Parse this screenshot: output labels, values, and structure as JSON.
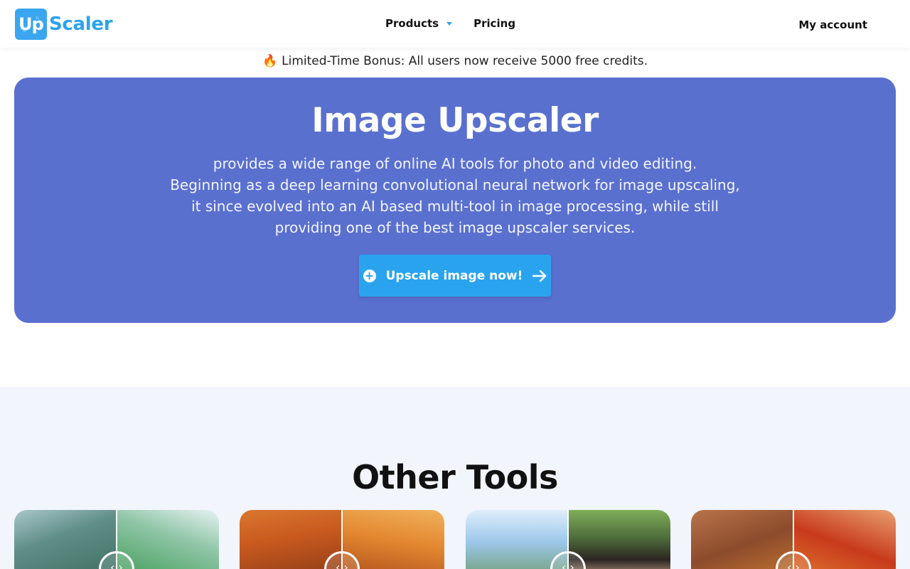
{
  "header": {
    "logo_badge": "Up",
    "logo_text": "Scaler",
    "nav": [
      {
        "label": "Products",
        "has_dropdown": true
      },
      {
        "label": "Pricing",
        "has_dropdown": false
      }
    ],
    "account_label": "My account"
  },
  "promo": {
    "icon": "fire-icon",
    "text": "Limited-Time Bonus: All users now receive 5000 free credits."
  },
  "hero": {
    "title": "Image Upscaler",
    "description_lines": [
      "provides a wide range of online AI tools for photo and video editing.",
      "Beginning as a deep learning convolutional neural network for image upscaling,",
      "it since evolved into an AI based multi-tool in image processing, while still",
      "providing one of the best image upscaler services."
    ],
    "cta_label": "Upscale image now!"
  },
  "tools": {
    "title": "Other Tools",
    "cards": [
      {
        "name": "tool-card-1"
      },
      {
        "name": "tool-card-2"
      },
      {
        "name": "tool-card-3"
      },
      {
        "name": "tool-card-4"
      }
    ]
  },
  "colors": {
    "brand": "#2aa3ee",
    "hero_bg": "#5a70cf",
    "section_bg": "#f2f5fb"
  }
}
